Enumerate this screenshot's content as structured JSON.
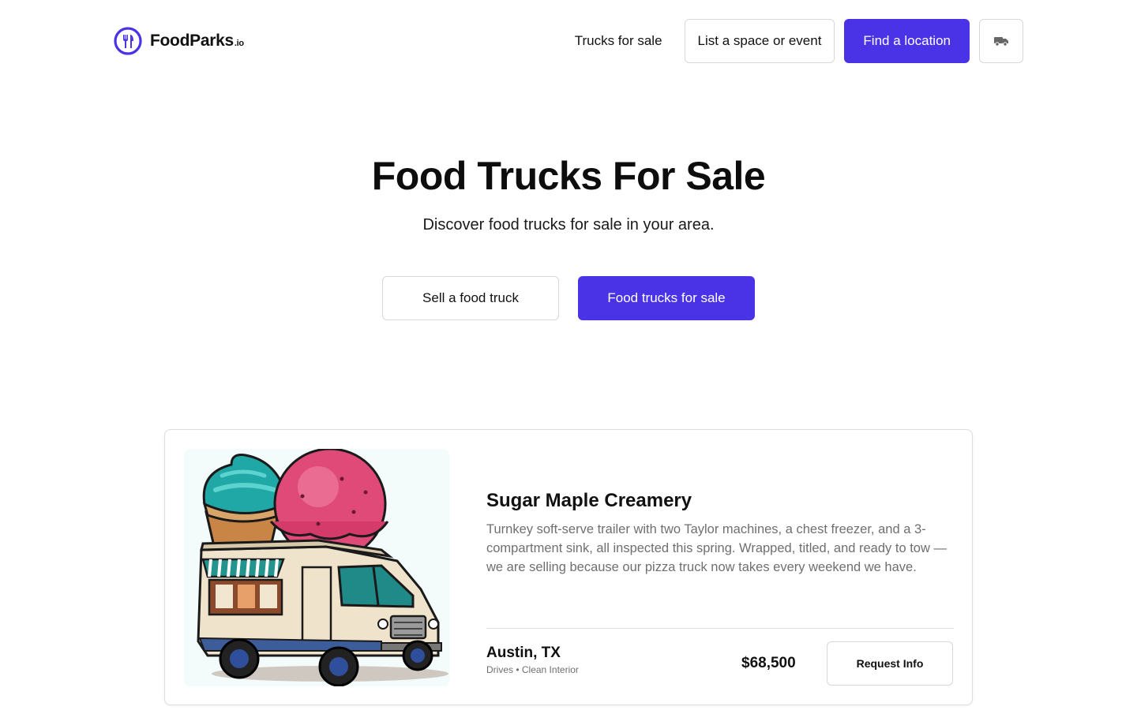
{
  "brand": {
    "name": "FoodParks",
    "tld": ".io",
    "accent_color": "#4a33e6"
  },
  "nav": {
    "trucks_for_sale": "Trucks for sale",
    "list_space": "List a space or event",
    "find_location": "Find a location",
    "truck_icon": "truck-icon"
  },
  "hero": {
    "title": "Food Trucks For Sale",
    "subtitle": "Discover food trucks for sale in your area.",
    "sell_button": "Sell a food truck",
    "browse_button": "Food trucks for sale"
  },
  "listing": {
    "title": "Sugar Maple Creamery",
    "description": "Turnkey soft-serve trailer with two Taylor machines, a chest freezer, and a 3-compartment sink, all inspected this spring. Wrapped, titled, and ready to tow — we are selling because our pizza truck now takes every weekend we have.",
    "location": "Austin, TX",
    "tags": "Drives • Clean Interior",
    "price": "$68,500",
    "cta": "Request Info",
    "image_icon": "ice-cream-truck-illustration"
  }
}
